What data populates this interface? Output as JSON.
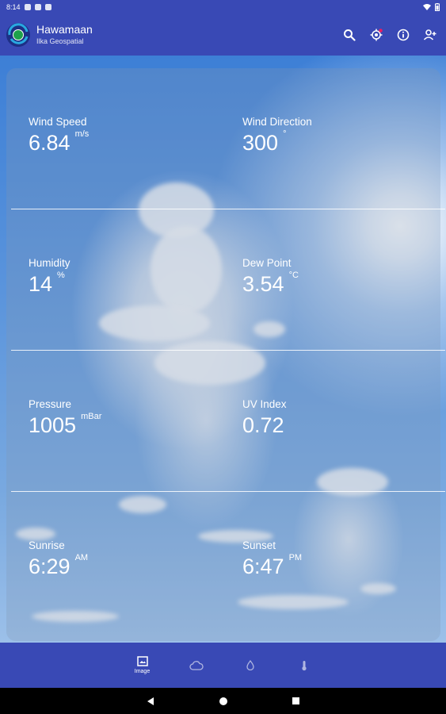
{
  "status_bar": {
    "time": "8:14"
  },
  "app_bar": {
    "title": "Hawamaan",
    "subtitle": "Ilka Geospatial",
    "actions": [
      "search-icon",
      "location-icon",
      "info-icon",
      "account-icon"
    ]
  },
  "weather": {
    "wind_speed": {
      "label": "Wind Speed",
      "value": "6.84",
      "unit": "m/s"
    },
    "wind_direction": {
      "label": "Wind Direction",
      "value": "300",
      "unit": "°"
    },
    "humidity": {
      "label": "Humidity",
      "value": "14",
      "unit": "%"
    },
    "dew_point": {
      "label": "Dew Point",
      "value": "3.54",
      "unit": "°C"
    },
    "pressure": {
      "label": "Pressure",
      "value": "1005",
      "unit": "mBar"
    },
    "uv_index": {
      "label": "UV Index",
      "value": "0.72",
      "unit": ""
    },
    "sunrise": {
      "label": "Sunrise",
      "value": "6:29",
      "unit": "AM"
    },
    "sunset": {
      "label": "Sunset",
      "value": "6:47",
      "unit": "PM"
    }
  },
  "bottom_nav": {
    "items": [
      {
        "icon": "image-icon",
        "label": "Image",
        "active": true
      },
      {
        "icon": "cloud-icon",
        "label": "",
        "active": false
      },
      {
        "icon": "drop-icon",
        "label": "",
        "active": false
      },
      {
        "icon": "thermometer-icon",
        "label": "",
        "active": false
      }
    ]
  },
  "colors": {
    "primary": "#3949b5",
    "notification_dot": "#e91e63"
  }
}
